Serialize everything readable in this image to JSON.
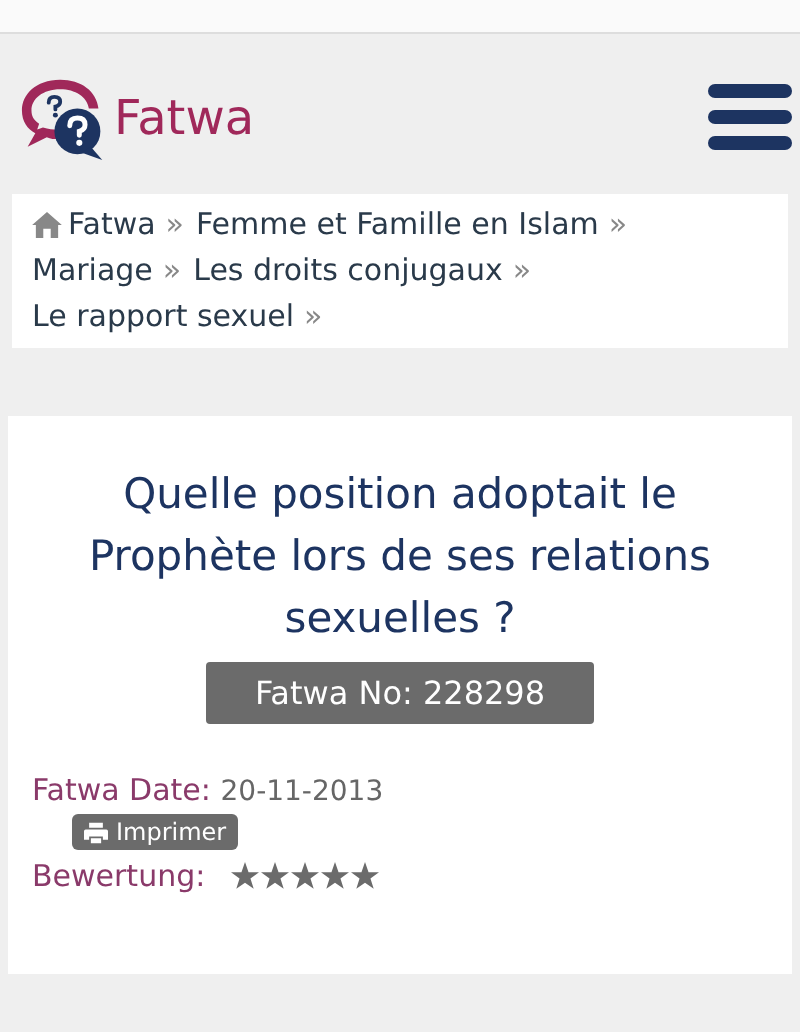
{
  "header": {
    "logo_text": "Fatwa"
  },
  "breadcrumb": [
    {
      "label": "Fatwa",
      "separator": "»",
      "kind": "home"
    },
    {
      "label": "Femme et Famille en Islam",
      "separator": "»",
      "kind": "link"
    },
    {
      "label": "Mariage",
      "separator": "»",
      "kind": "link"
    },
    {
      "label": "Les droits conjugaux",
      "separator": "»",
      "kind": "link"
    },
    {
      "label": "Le rapport sexuel",
      "separator": "»",
      "kind": "link"
    }
  ],
  "article": {
    "title": "Quelle position adoptait le Prophète lors de ses relations sexuelles ?",
    "number": "Fatwa No: 228298",
    "date_label": "Fatwa Date:",
    "date": "20-11-2013",
    "print_button": "Imprimer",
    "rating_label": "Bewertung:",
    "stars": 5
  }
}
